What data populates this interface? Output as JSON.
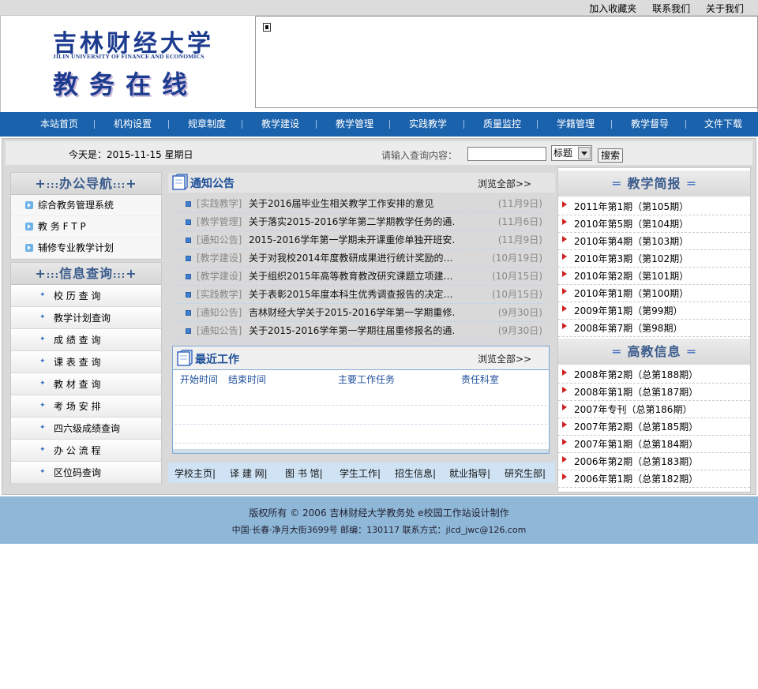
{
  "top_links": [
    "加入收藏夹",
    "联系我们",
    "关于我们"
  ],
  "logo": {
    "name_cn": "吉林财经大学",
    "name_en": "JILIN UNIVERSITY OF FINANCE AND ECONOMICS",
    "subtitle": "教务在线"
  },
  "nav": [
    "本站首页",
    "机构设置",
    "规章制度",
    "教学建设",
    "教学管理",
    "实践教学",
    "质量监控",
    "学籍管理",
    "教学督导",
    "文件下载"
  ],
  "datebar": {
    "date_text": "今天是：2015-11-15 星期日",
    "search_label": "请输入查询内容：",
    "search_value": "",
    "select_value": "标题",
    "search_button": "搜索"
  },
  "office_nav": {
    "title": "办公导航",
    "items": [
      "综合教务管理系统",
      "教 务 F T P",
      "辅修专业教学计划"
    ]
  },
  "info_query": {
    "title": "信息查询",
    "items": [
      "校 历 查 询",
      "教学计划查询",
      "成 绩 查 询",
      "课 表 查 询",
      "教 材 查 询",
      "考 场 安 排",
      "四六级成绩查询",
      "办 公 流 程",
      "区位码查询"
    ]
  },
  "notices": {
    "title": "通知公告",
    "more": "浏览全部>>",
    "items": [
      {
        "cat": "[实践教学]",
        "title": "关于2016届毕业生相关教学工作安排的意见",
        "date": "(11月9日)"
      },
      {
        "cat": "[教学管理]",
        "title": "关于落实2015-2016学年第二学期教学任务的通…",
        "date": "(11月6日)"
      },
      {
        "cat": "[通知公告]",
        "title": "2015-2016学年第一学期未开课重修单独开班安…",
        "date": "(11月9日)"
      },
      {
        "cat": "[教学建设]",
        "title": "关于对我校2014年度教研成果进行统计奖励的…",
        "date": "(10月19日)"
      },
      {
        "cat": "[教学建设]",
        "title": "关于组织2015年高等教育教改研究课题立项建…",
        "date": "(10月15日)"
      },
      {
        "cat": "[实践教学]",
        "title": "关于表彰2015年度本科生优秀调查报告的决定…",
        "date": "(10月15日)"
      },
      {
        "cat": "[通知公告]",
        "title": "吉林财经大学关于2015-2016学年第一学期重修…",
        "date": "(9月30日)"
      },
      {
        "cat": "[通知公告]",
        "title": "关于2015-2016学年第一学期往届重修报名的通…",
        "date": "(9月30日)"
      }
    ]
  },
  "recent_work": {
    "title": "最近工作",
    "more": "浏览全部>>",
    "columns": [
      "开始时间",
      "结束时间",
      "主要工作任务",
      "责任科室"
    ]
  },
  "links": [
    "学校主页|",
    "译 建 网|",
    "图 书 馆|",
    "学生工作|",
    "招生信息|",
    "就业指导|",
    "研究生部|"
  ],
  "teaching_brief": {
    "title": "教学简报",
    "items": [
      "2011年第1期（第105期）",
      "2010年第5期（第104期）",
      "2010年第4期（第103期）",
      "2010年第3期（第102期）",
      "2010年第2期（第101期）",
      "2010年第1期（第100期）",
      "2009年第1期（第99期）",
      "2008年第7期（第98期）"
    ]
  },
  "higher_edu": {
    "title": "高教信息",
    "items": [
      "2008年第2期（总第188期）",
      "2008年第1期（总第187期）",
      "2007年专刊（总第186期）",
      "2007年第2期（总第185期）",
      "2007年第1期（总第184期）",
      "2006年第2期（总第183期）",
      "2006年第1期（总第182期）"
    ]
  },
  "footer": {
    "line1": "版权所有 © 2006 吉林财经大学教务处 e校园工作站设计制作",
    "line2": "中国·长春·净月大街3699号 邮编：130117 联系方式：jlcd_jwc@126.com"
  },
  "colors": {
    "nav_bg": "#1b62ad",
    "footer_bg": "#8fb7d7",
    "heading": "#3a5b8c",
    "brief_bullet": "#cf1f1f"
  }
}
